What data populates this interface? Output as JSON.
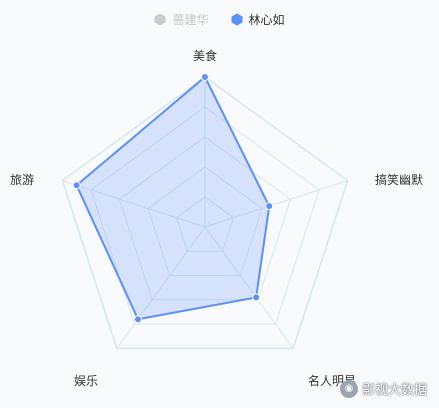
{
  "chart_data": {
    "type": "radar",
    "indicators": [
      "美食",
      "搞笑幽默",
      "名人明星",
      "娱乐",
      "旅游"
    ],
    "max": 100,
    "levels": 5,
    "series": [
      {
        "name": "蔷建华",
        "values": [],
        "color": "#c6c6c6",
        "visible": false
      },
      {
        "name": "林心如",
        "values": [
          100,
          45,
          58,
          76,
          90
        ],
        "color": "#5b8ff9",
        "visible": true
      }
    ],
    "legend_position": "top-center",
    "grid_color": "#d6e6f2"
  },
  "watermark": {
    "icon": "wechat-logo-icon",
    "text": "影视大数据"
  }
}
